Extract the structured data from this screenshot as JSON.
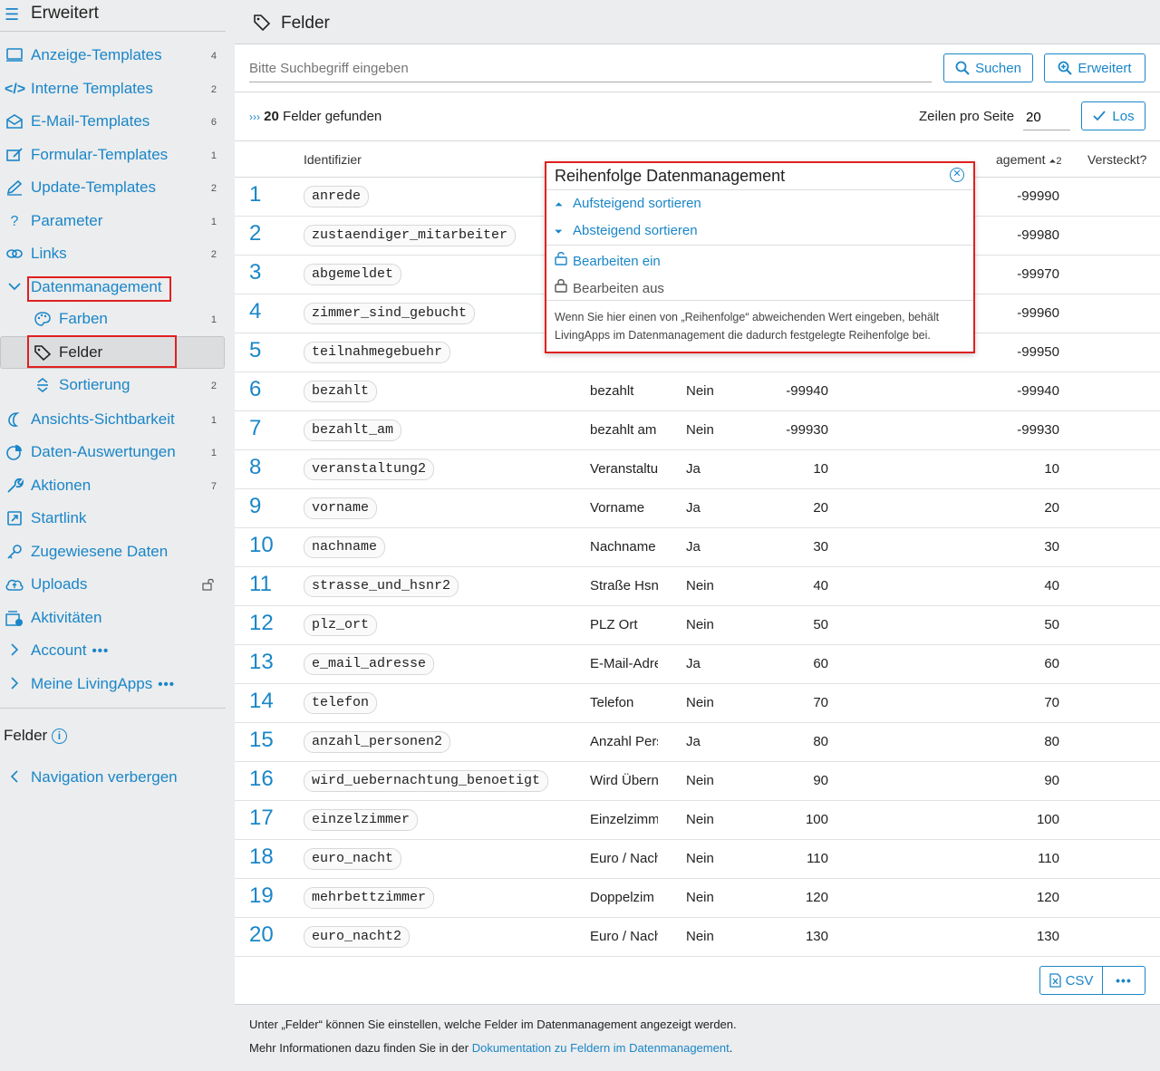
{
  "sidebar": {
    "title": "Erweitert",
    "items": [
      {
        "label": "Anzeige-Templates",
        "count": "4",
        "icon": "monitor-icon"
      },
      {
        "label": "Interne Templates",
        "count": "2",
        "icon": "code-icon"
      },
      {
        "label": "E-Mail-Templates",
        "count": "6",
        "icon": "envelope-icon"
      },
      {
        "label": "Formular-Templates",
        "count": "1",
        "icon": "form-edit-icon"
      },
      {
        "label": "Update-Templates",
        "count": "2",
        "icon": "pencil-icon"
      },
      {
        "label": "Parameter",
        "count": "1",
        "icon": "question-icon"
      },
      {
        "label": "Links",
        "count": "2",
        "icon": "link-icon"
      },
      {
        "label": "Datenmanagement",
        "count": "",
        "icon": "chevron-down-icon"
      },
      {
        "label": "Farben",
        "count": "1",
        "icon": "palette-icon"
      },
      {
        "label": "Felder",
        "count": "",
        "icon": "tag-icon"
      },
      {
        "label": "Sortierung",
        "count": "2",
        "icon": "sort-icon"
      },
      {
        "label": "Ansichts-Sichtbarkeit",
        "count": "1",
        "icon": "moon-icon"
      },
      {
        "label": "Daten-Auswertungen",
        "count": "1",
        "icon": "pie-chart-icon"
      },
      {
        "label": "Aktionen",
        "count": "7",
        "icon": "wrench-icon"
      },
      {
        "label": "Startlink",
        "count": "",
        "icon": "external-link-icon"
      },
      {
        "label": "Zugewiesene Daten",
        "count": "",
        "icon": "key-icon"
      },
      {
        "label": "Uploads",
        "count": "",
        "icon": "cloud-upload-icon"
      },
      {
        "label": "Aktivitäten",
        "count": "",
        "icon": "activity-icon"
      },
      {
        "label": "Account",
        "count": "",
        "icon": "chevron-right-icon"
      },
      {
        "label": "Meine LivingApps",
        "count": "",
        "icon": "chevron-right-icon"
      }
    ],
    "more_dots": "•••",
    "section_title": "Felder",
    "hide_nav": "Navigation verbergen"
  },
  "header": {
    "title": "Felder"
  },
  "search": {
    "placeholder": "Bitte Suchbegriff eingeben",
    "search_label": "Suchen",
    "advanced_label": "Erweitert"
  },
  "results": {
    "count": "20",
    "label": "Felder gefunden",
    "rows_per_page_label": "Zeilen pro Seite",
    "rows_per_page": "20",
    "go_label": "Los"
  },
  "table": {
    "headers": {
      "identifier": "Identifizier",
      "datamgmt": "agement",
      "sort_index": "2",
      "hidden": "Versteckt?"
    },
    "rows": [
      {
        "n": "1",
        "id": "anrede",
        "name": "",
        "inlist": "",
        "order": "",
        "order_dm": "-99990"
      },
      {
        "n": "2",
        "id": "zustaendiger_mitarbeiter",
        "name": "",
        "inlist": "",
        "order": "",
        "order_dm": "-99980"
      },
      {
        "n": "3",
        "id": "abgemeldet",
        "name": "",
        "inlist": "",
        "order": "",
        "order_dm": "-99970"
      },
      {
        "n": "4",
        "id": "zimmer_sind_gebucht",
        "name": "",
        "inlist": "",
        "order": "",
        "order_dm": "-99960"
      },
      {
        "n": "5",
        "id": "teilnahmegebuehr",
        "name": "",
        "inlist": "",
        "order": "",
        "order_dm": "-99950"
      },
      {
        "n": "6",
        "id": "bezahlt",
        "name": "bezahlt",
        "inlist": "Nein",
        "order": "-99940",
        "order_dm": "-99940"
      },
      {
        "n": "7",
        "id": "bezahlt_am",
        "name": "bezahlt am",
        "inlist": "Nein",
        "order": "-99930",
        "order_dm": "-99930"
      },
      {
        "n": "8",
        "id": "veranstaltung2",
        "name": "Veranstaltu",
        "inlist": "Ja",
        "order": "10",
        "order_dm": "10"
      },
      {
        "n": "9",
        "id": "vorname",
        "name": "Vorname",
        "inlist": "Ja",
        "order": "20",
        "order_dm": "20"
      },
      {
        "n": "10",
        "id": "nachname",
        "name": "Nachname",
        "inlist": "Ja",
        "order": "30",
        "order_dm": "30"
      },
      {
        "n": "11",
        "id": "strasse_und_hsnr2",
        "name": "Straße Hsn",
        "inlist": "Nein",
        "order": "40",
        "order_dm": "40"
      },
      {
        "n": "12",
        "id": "plz_ort",
        "name": "PLZ Ort",
        "inlist": "Nein",
        "order": "50",
        "order_dm": "50"
      },
      {
        "n": "13",
        "id": "e_mail_adresse",
        "name": "E-Mail-Adre",
        "inlist": "Ja",
        "order": "60",
        "order_dm": "60"
      },
      {
        "n": "14",
        "id": "telefon",
        "name": "Telefon",
        "inlist": "Nein",
        "order": "70",
        "order_dm": "70"
      },
      {
        "n": "15",
        "id": "anzahl_personen2",
        "name": "Anzahl Pers",
        "inlist": "Ja",
        "order": "80",
        "order_dm": "80"
      },
      {
        "n": "16",
        "id": "wird_uebernachtung_benoetigt",
        "name": "Wird Übern",
        "inlist": "Nein",
        "order": "90",
        "order_dm": "90"
      },
      {
        "n": "17",
        "id": "einzelzimmer",
        "name": "Einzelzimm",
        "inlist": "Nein",
        "order": "100",
        "order_dm": "100"
      },
      {
        "n": "18",
        "id": "euro_nacht",
        "name": "Euro / Nach",
        "inlist": "Nein",
        "order": "110",
        "order_dm": "110"
      },
      {
        "n": "19",
        "id": "mehrbettzimmer",
        "name": "Doppelzim",
        "inlist": "Nein",
        "order": "120",
        "order_dm": "120"
      },
      {
        "n": "20",
        "id": "euro_nacht2",
        "name": "Euro / Nach",
        "inlist": "Nein",
        "order": "130",
        "order_dm": "130"
      }
    ]
  },
  "export": {
    "csv_label": "CSV",
    "more_label": "•••"
  },
  "popup": {
    "title": "Reihenfolge Datenmanagement",
    "sort_asc": "Aufsteigend sortieren",
    "sort_desc": "Absteigend sortieren",
    "edit_on": "Bearbeiten ein",
    "edit_off": "Bearbeiten aus",
    "note": "Wenn Sie hier einen von „Reihenfolge“ abweichenden Wert eingeben, behält LivingApps im Datenmanagement die dadurch festgelegte Reihenfolge bei."
  },
  "footer": {
    "line1": "Unter „Felder“ können Sie einstellen, welche Felder im Datenmanagement angezeigt werden.",
    "line2_prefix": "Mehr Informationen dazu finden Sie in der ",
    "line2_link": "Dokumentation zu Feldern im Datenmanagement",
    "line2_suffix": "."
  },
  "colors": {
    "accent": "#1a86c8",
    "highlight": "#e02020"
  }
}
